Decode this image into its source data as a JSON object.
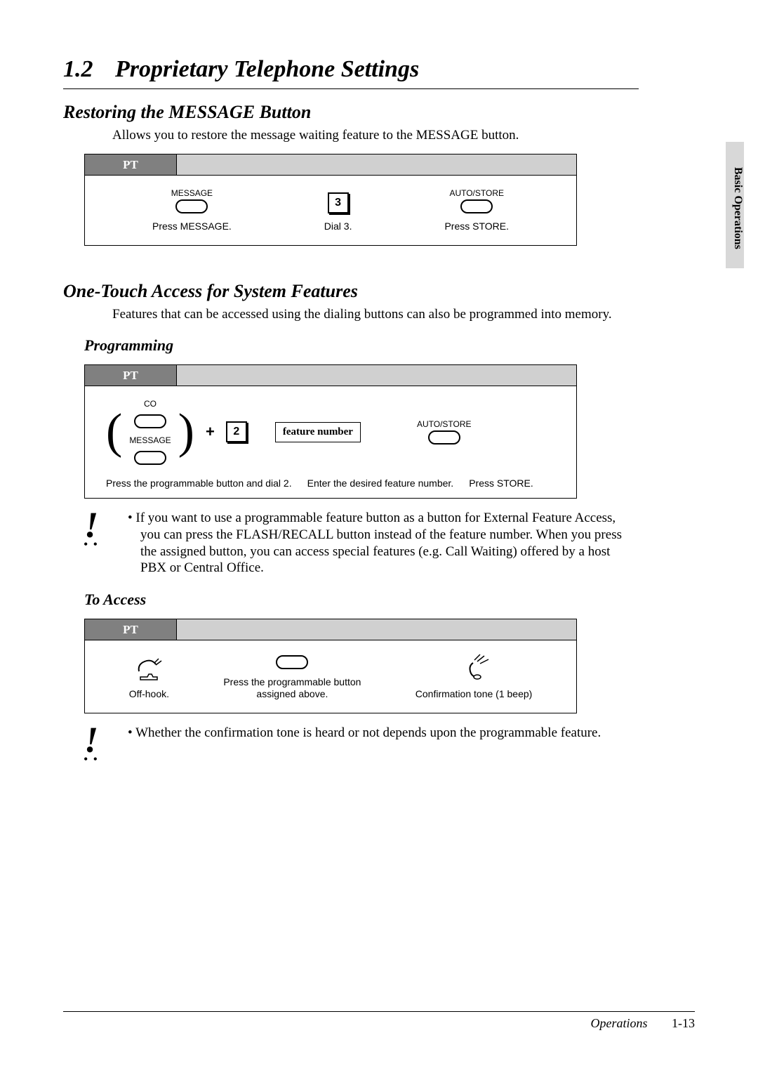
{
  "section": {
    "number": "1.2",
    "title": "Proprietary Telephone Settings"
  },
  "side_tab": "Basic Operations",
  "sub1": {
    "heading": "Restoring the MESSAGE Button",
    "desc": "Allows you to restore the message waiting feature to the MESSAGE button.",
    "pt_label": "PT",
    "steps": {
      "msg_top": "MESSAGE",
      "msg_cap": "Press MESSAGE.",
      "dial_key": "3",
      "dial_cap": "Dial 3.",
      "store_top": "AUTO/STORE",
      "store_cap": "Press STORE."
    }
  },
  "sub2": {
    "heading": "One-Touch Access for System Features",
    "desc": "Features that can be accessed using the dialing buttons can also be programmed into memory.",
    "prog_heading": "Programming",
    "pt_label": "PT",
    "steps": {
      "co": "CO",
      "msg": "MESSAGE",
      "plus": "+",
      "key": "2",
      "feature_box": "feature number",
      "store_top": "AUTO/STORE",
      "cap1": "Press the programmable button and dial 2.",
      "cap2": "Enter the desired feature number.",
      "cap3": "Press STORE."
    },
    "note1": "If you want to use a programmable feature button as a button for External Feature Access, you can press the FLASH/RECALL button instead of the feature number. When you press the assigned button, you can access special features (e.g. Call Waiting) offered by a host PBX or Central Office.",
    "access_heading": "To Access",
    "pt_label2": "PT",
    "access": {
      "cap1": "Off-hook.",
      "cap2": "Press the programmable button assigned above.",
      "cap3": "Confirmation tone (1 beep)"
    },
    "note2": "Whether the confirmation tone is heard or not depends upon the programmable feature."
  },
  "footer": {
    "label": "Operations",
    "page": "1-13"
  }
}
